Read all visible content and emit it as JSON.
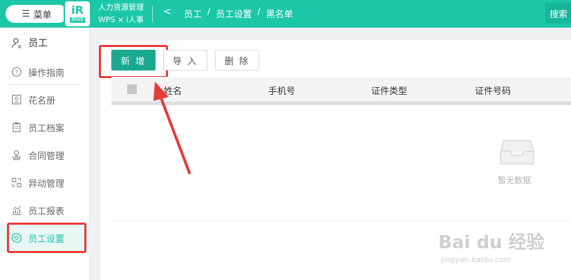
{
  "header": {
    "menu_label": "菜单",
    "logo_mark": "iR",
    "logo_sub": "基础版",
    "app_title": "人力资源管理",
    "app_subtitle": "WPS × i人事",
    "back_glyph": "<",
    "breadcrumb": [
      "员工",
      "/",
      "员工设置",
      "/",
      "黑名单"
    ],
    "search_label": "搜索"
  },
  "sidebar": {
    "items": [
      {
        "label": "员工",
        "icon": "user-icon"
      },
      {
        "label": "操作指南",
        "icon": "help-circle-icon"
      },
      {
        "label": "花名册",
        "icon": "roster-icon"
      },
      {
        "label": "员工档案",
        "icon": "clipboard-icon"
      },
      {
        "label": "合同管理",
        "icon": "stamp-icon"
      },
      {
        "label": "异动管理",
        "icon": "transfer-icon"
      },
      {
        "label": "员工报表",
        "icon": "chart-icon"
      },
      {
        "label": "员工设置",
        "icon": "gear-icon",
        "active": true
      }
    ]
  },
  "toolbar": {
    "add_label": "新 增",
    "import_label": "导 入",
    "delete_label": "删 除"
  },
  "table": {
    "columns": [
      "姓名",
      "手机号",
      "证件类型",
      "证件号码"
    ],
    "empty_text": "暂无数据"
  },
  "watermark": {
    "brand": "Bai du 经验",
    "url": "jingyan.baidu.com"
  },
  "colors": {
    "accent": "#1cc7a8",
    "primary_button": "#1aa88f",
    "highlight_red": "#e63b3b"
  }
}
